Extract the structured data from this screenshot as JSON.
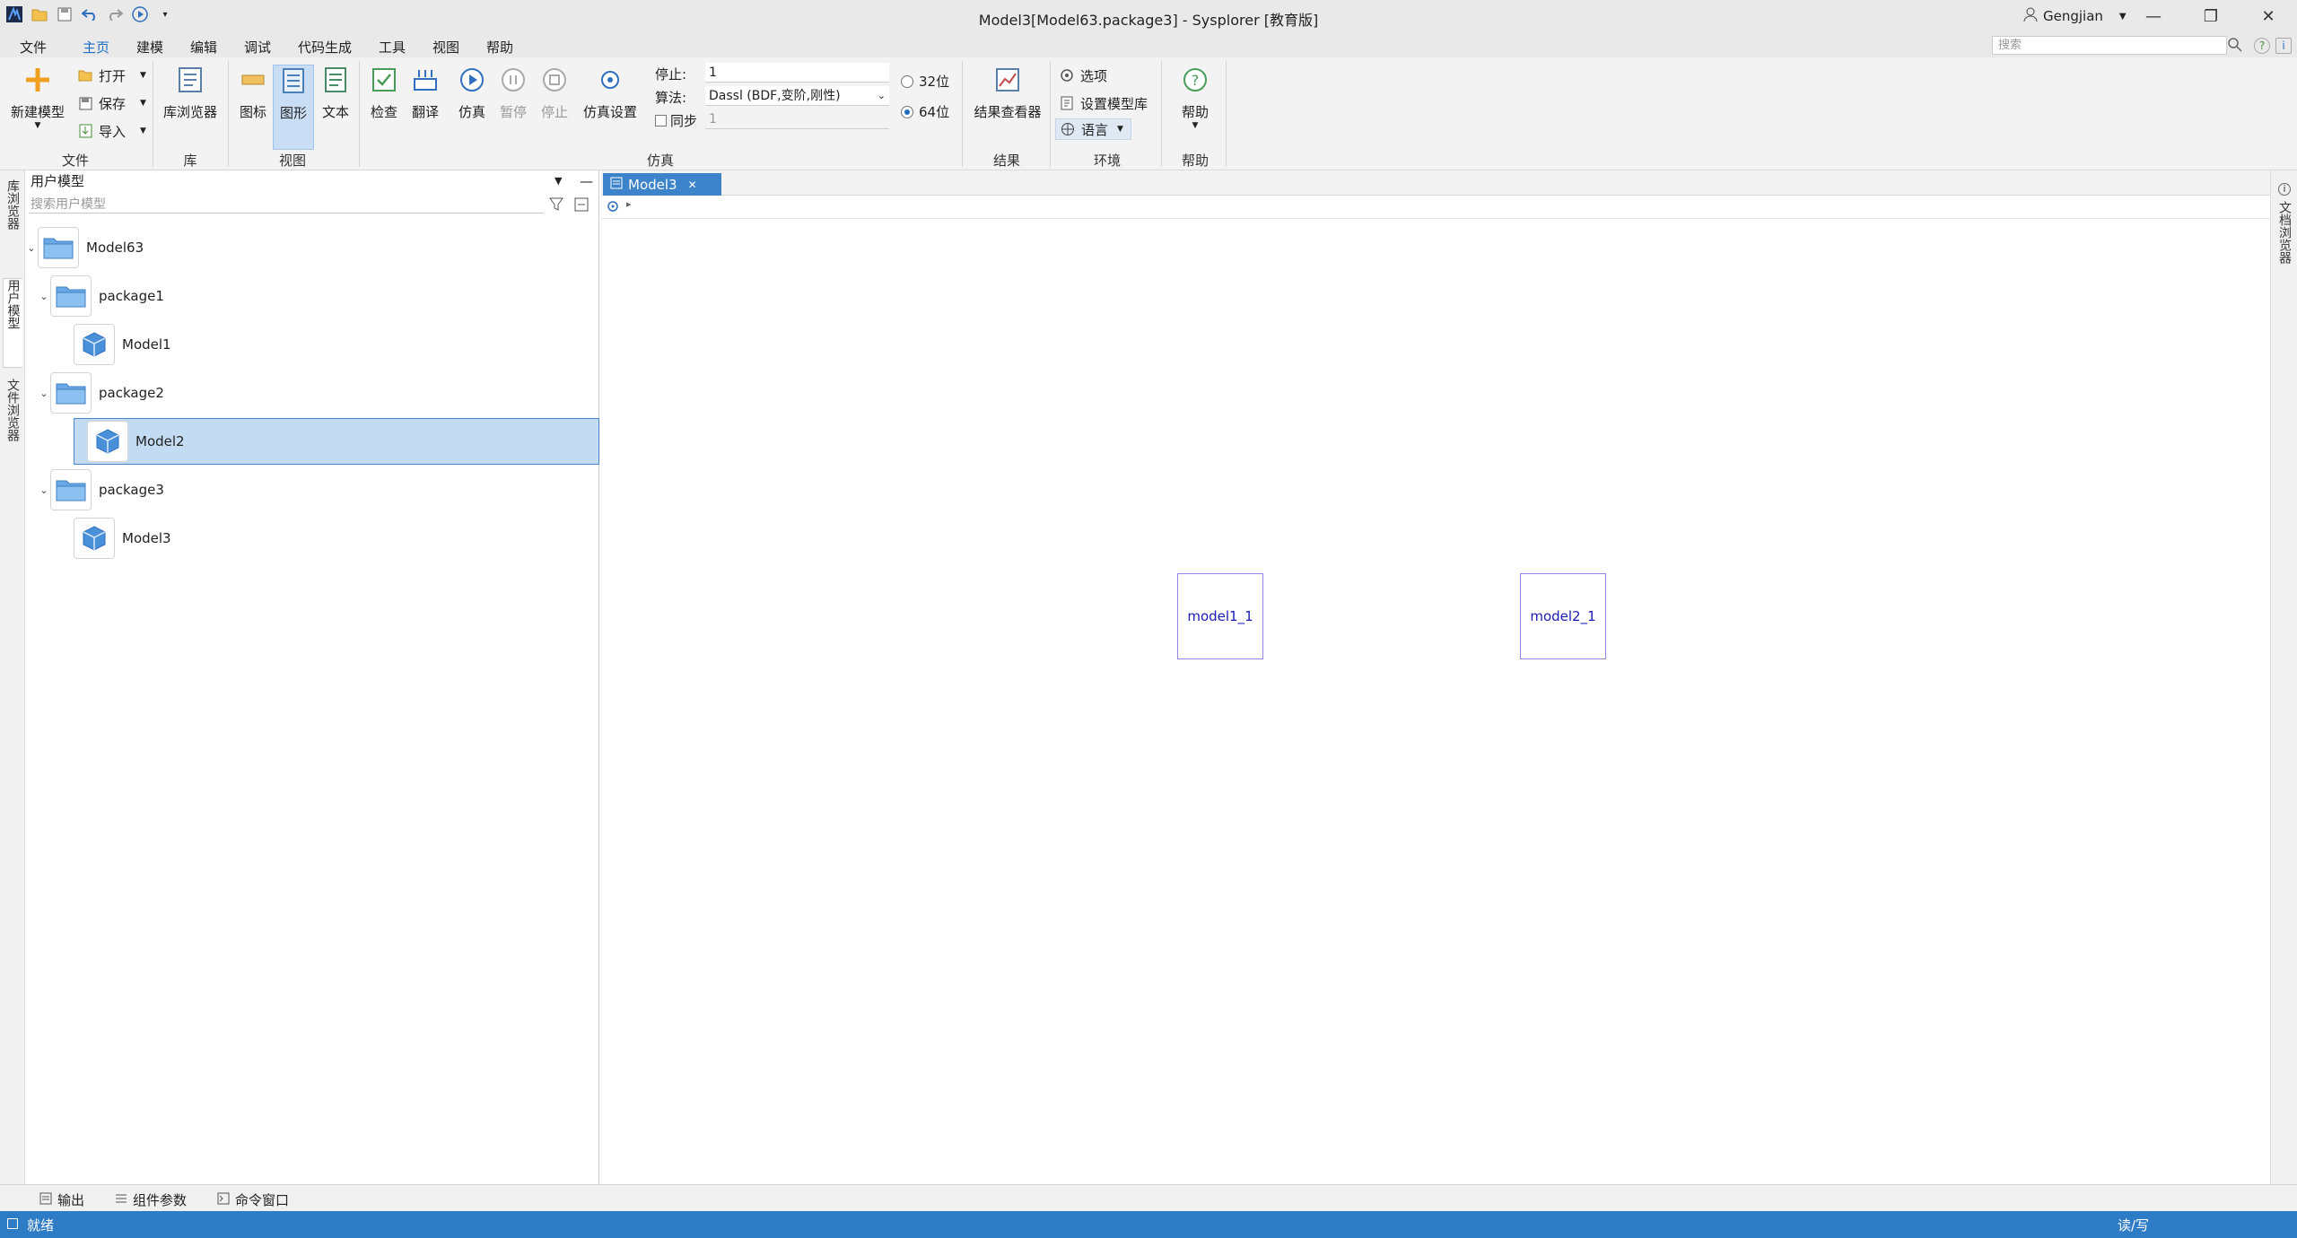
{
  "window": {
    "title": "Model3[Model63.package3] - Sysplorer [教育版]",
    "user": "Gengjian",
    "search_placeholder": "搜索"
  },
  "menu": {
    "items": [
      "文件",
      "主页",
      "建模",
      "编辑",
      "调试",
      "代码生成",
      "工具",
      "视图",
      "帮助"
    ],
    "active": "主页"
  },
  "ribbon": {
    "file": {
      "new_model": "新建模型",
      "open": "打开",
      "save": "保存",
      "import": "导入",
      "group": "文件"
    },
    "library": {
      "browser": "库浏览器",
      "group": "库"
    },
    "view": {
      "icon": "图标",
      "diagram": "图形",
      "text": "文本",
      "group": "视图"
    },
    "simulation": {
      "check": "检查",
      "translate": "翻译",
      "simulate": "仿真",
      "pause": "暂停",
      "stop": "停止",
      "settings": "仿真设置",
      "stop_label": "停止:",
      "stop_value": "1",
      "algorithm_label": "算法:",
      "algorithm_value": "Dassl (BDF,变阶,刚性)",
      "sync_label": "同步",
      "sync_value": "1",
      "bit32": "32位",
      "bit64": "64位",
      "selected_bits": "64位",
      "group": "仿真"
    },
    "results": {
      "viewer": "结果查看器",
      "group": "结果"
    },
    "environment": {
      "options": "选项",
      "set_library": "设置模型库",
      "language": "语言",
      "group": "环境"
    },
    "help": {
      "help": "帮助",
      "group": "帮助"
    }
  },
  "left_strip": {
    "tabs": [
      "库浏览器",
      "用户模型",
      "文件浏览器"
    ],
    "active": "用户模型"
  },
  "panel": {
    "title": "用户模型",
    "search_placeholder": "搜索用户模型",
    "tree": [
      {
        "label": "Model63",
        "type": "folder",
        "level": 0,
        "expanded": true
      },
      {
        "label": "package1",
        "type": "folder",
        "level": 1,
        "expanded": true
      },
      {
        "label": "Model1",
        "type": "model",
        "level": 2
      },
      {
        "label": "package2",
        "type": "folder",
        "level": 1,
        "expanded": true
      },
      {
        "label": "Model2",
        "type": "model",
        "level": 2,
        "selected": true
      },
      {
        "label": "package3",
        "type": "folder",
        "level": 1,
        "expanded": true
      },
      {
        "label": "Model3",
        "type": "model",
        "level": 2
      }
    ]
  },
  "editor": {
    "tab": "Model3",
    "components": [
      {
        "name": "model1_1"
      },
      {
        "name": "model2_1"
      }
    ]
  },
  "right_strip": {
    "tab": "文档浏览器"
  },
  "bottom_tabs": [
    "输出",
    "组件参数",
    "命令窗口"
  ],
  "status": {
    "left": "就绪",
    "right": "读/写"
  },
  "colors": {
    "accent": "#2f7cc6",
    "selection": "#c3dcf3",
    "component_border": "#8f86e6",
    "component_text": "#1a1ab8"
  }
}
